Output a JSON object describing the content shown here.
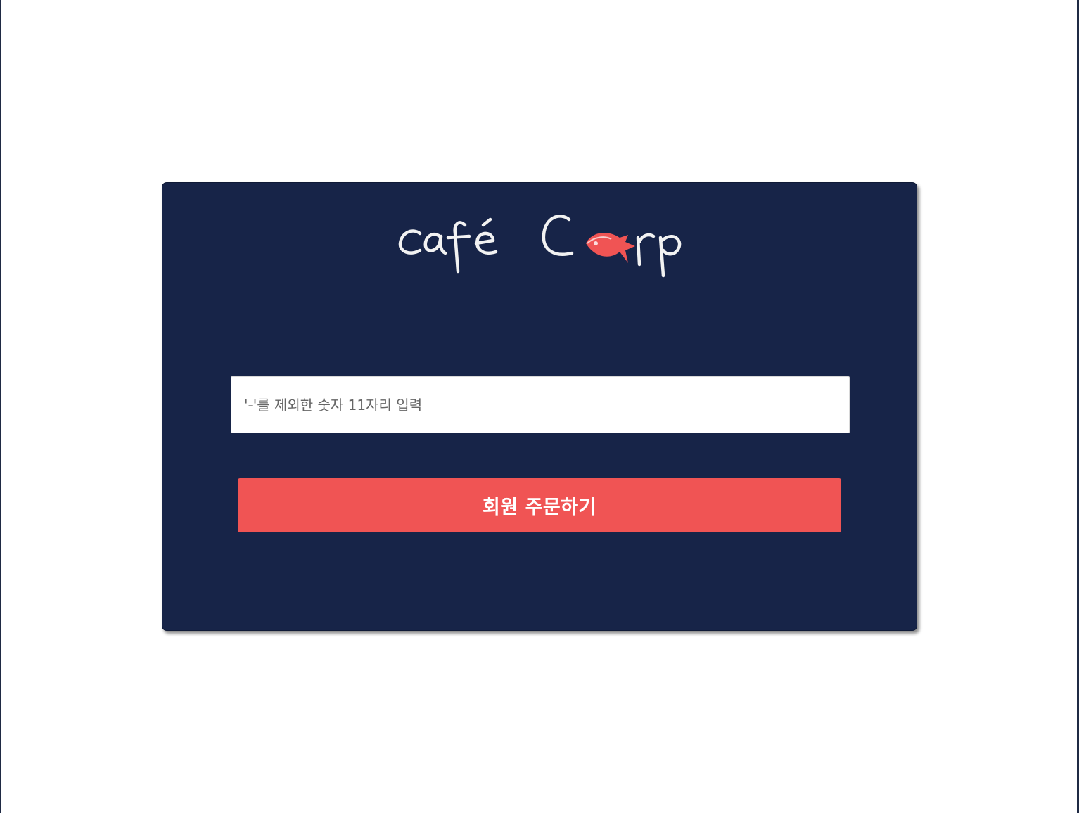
{
  "logo": {
    "part1": "café",
    "part2_prefix": "C",
    "part2_suffix": "rp",
    "fish_color": "#f05454",
    "text_color": "#f2f2f2",
    "icon": "fish-icon"
  },
  "login": {
    "phone_placeholder": "'-'를 제외한 숫자 11자리 입력",
    "phone_value": "",
    "submit_label": "회원 주문하기"
  },
  "colors": {
    "card_background": "#172448",
    "button_background": "#f05454",
    "page_background": "#ffffff"
  }
}
